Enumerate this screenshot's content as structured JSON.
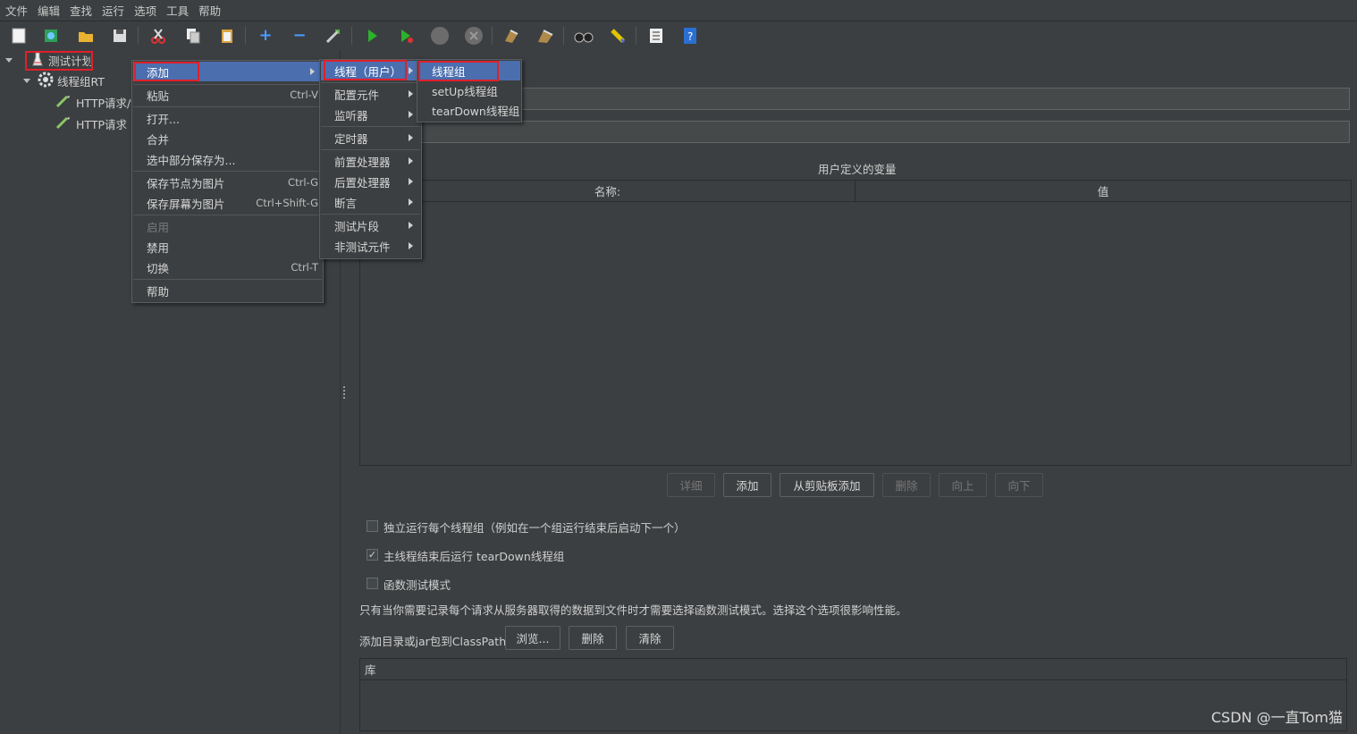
{
  "menubar": {
    "items": [
      "文件",
      "编辑",
      "查找",
      "运行",
      "选项",
      "工具",
      "帮助"
    ]
  },
  "toolbar": {
    "icons": [
      "new-icon",
      "templates-icon",
      "open-icon",
      "save-icon",
      "cut-icon",
      "copy-icon",
      "paste-icon",
      "expand-icon",
      "collapse-icon",
      "toggle-icon",
      "start-icon",
      "start-no-pause-icon",
      "stop-icon",
      "shutdown-icon",
      "clear-icon",
      "clear-all-icon",
      "search-icon",
      "reset-search-icon",
      "function-helper-icon",
      "help-icon"
    ]
  },
  "tree": {
    "root_label": "测试计划",
    "thread_group_label": "线程组RT",
    "http1_label": "HTTP请求/t",
    "http2_label": "HTTP请求"
  },
  "context_menu": {
    "add": "添加",
    "paste": "粘贴",
    "paste_sc": "Ctrl-V",
    "open": "打开...",
    "merge": "合并",
    "save_selection_as": "选中部分保存为...",
    "save_node_as_image": "保存节点为图片",
    "save_node_sc": "Ctrl-G",
    "save_screen_as_image": "保存屏幕为图片",
    "save_screen_sc": "Ctrl+Shift-G",
    "enable": "启用",
    "disable": "禁用",
    "toggle": "切换",
    "toggle_sc": "Ctrl-T",
    "help": "帮助"
  },
  "add_submenu": {
    "threads": "线程（用户）",
    "config_element": "配置元件",
    "listener": "监听器",
    "timer": "定时器",
    "pre_processor": "前置处理器",
    "post_processor": "后置处理器",
    "assertion": "断言",
    "test_fragment": "测试片段",
    "non_test_elements": "非测试元件"
  },
  "threads_submenu": {
    "thread_group": "线程组",
    "setup_thread_group": "setUp线程组",
    "teardown_thread_group": "tearDown线程组"
  },
  "main": {
    "udv_title": "用户定义的变量",
    "col_name": "名称:",
    "col_value": "值",
    "buttons": {
      "detail": "详细",
      "add": "添加",
      "add_from_clipboard": "从剪贴板添加",
      "delete": "删除",
      "up": "向上",
      "down": "向下"
    },
    "checkbox_serial": {
      "label": "独立运行每个线程组（例如在一个组运行结束后启动下一个）",
      "checked": false
    },
    "checkbox_teardown": {
      "label": "主线程结束后运行 tearDown线程组",
      "checked": true
    },
    "checkbox_functional": {
      "label": "函数测试模式",
      "checked": false
    },
    "functional_note": "只有当你需要记录每个请求从服务器取得的数据到文件时才需要选择函数测试模式。选择这个选项很影响性能。",
    "classpath_label": "添加目录或jar包到ClassPath",
    "classpath_buttons": {
      "browse": "浏览...",
      "delete": "删除",
      "clear": "清除"
    },
    "library_header": "库"
  },
  "watermark": "CSDN @一直Tom猫"
}
